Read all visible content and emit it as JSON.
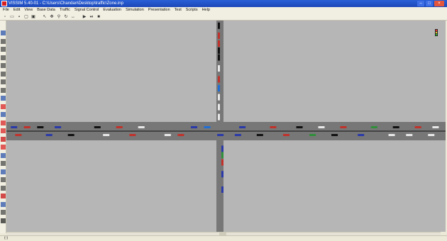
{
  "window": {
    "title": "VISSIM 5.40-01 - C:\\Users\\Chandan\\Desktop\\traffic\\Zone.inp",
    "minimize_glyph": "–",
    "maximize_glyph": "□",
    "close_glyph": "×"
  },
  "menu": [
    "File",
    "Edit",
    "View",
    "Base Data",
    "Traffic",
    "Signal Control",
    "Evaluation",
    "Simulation",
    "Presentation",
    "Test",
    "Scripts",
    "Help"
  ],
  "toolbar_icons": [
    "new-file-icon",
    "open-folder-icon",
    "save-icon",
    "print-preview-icon",
    "print-icon",
    "select-icon",
    "pan-icon",
    "zoom-icon",
    "rotate-icon",
    "measure-icon",
    "play-icon",
    "step-icon",
    "stop-icon"
  ],
  "left_toolbar_icons": [
    "links-icon",
    "connector-icon",
    "pen-icon",
    "hand-icon",
    "route-icon",
    "vehicle-input-icon",
    "priority-rule-icon",
    "selection-icon",
    "parking-icon",
    "signal-head-icon",
    "detector-icon",
    "speed-icon",
    "conflict-icon",
    "stop-sign-icon",
    "pt-stop-icon",
    "node-icon",
    "data-collection-icon",
    "queue-counter-icon",
    "travel-time-icon",
    "delay-icon",
    "warning-icon",
    "parking-lot-icon",
    "area-icon",
    "close-icon"
  ],
  "status": {
    "coordinates": "(-)",
    "field2": "",
    "field3": ""
  },
  "colors": {
    "background": "#b6b6b6",
    "road": "#777777",
    "centerline": "#111111"
  },
  "vehicles_horizontal_top": [
    {
      "x": 0.01,
      "color": "#2a3aa8"
    },
    {
      "x": 0.04,
      "color": "#c0322b"
    },
    {
      "x": 0.07,
      "color": "#111111"
    },
    {
      "x": 0.11,
      "color": "#2a3aa8"
    },
    {
      "x": 0.2,
      "color": "#111111"
    },
    {
      "x": 0.25,
      "color": "#c0322b"
    },
    {
      "x": 0.3,
      "color": "#e8e8e8"
    },
    {
      "x": 0.42,
      "color": "#2a3aa8"
    },
    {
      "x": 0.45,
      "color": "#1f6fd6"
    },
    {
      "x": 0.53,
      "color": "#2a3aa8"
    },
    {
      "x": 0.6,
      "color": "#c0322b"
    },
    {
      "x": 0.66,
      "color": "#111111"
    },
    {
      "x": 0.71,
      "color": "#e8e8e8"
    },
    {
      "x": 0.76,
      "color": "#c0322b"
    },
    {
      "x": 0.83,
      "color": "#2f8f3a"
    },
    {
      "x": 0.88,
      "color": "#111111"
    },
    {
      "x": 0.93,
      "color": "#c0322b"
    },
    {
      "x": 0.97,
      "color": "#e8e8e8"
    }
  ],
  "vehicles_horizontal_bottom": [
    {
      "x": 0.02,
      "color": "#c0322b"
    },
    {
      "x": 0.09,
      "color": "#2a3aa8"
    },
    {
      "x": 0.14,
      "color": "#111111"
    },
    {
      "x": 0.22,
      "color": "#e8e8e8"
    },
    {
      "x": 0.28,
      "color": "#c0322b"
    },
    {
      "x": 0.36,
      "color": "#e8e8e8"
    },
    {
      "x": 0.39,
      "color": "#c0322b"
    },
    {
      "x": 0.48,
      "color": "#2a3aa8"
    },
    {
      "x": 0.52,
      "color": "#2a3aa8"
    },
    {
      "x": 0.57,
      "color": "#111111"
    },
    {
      "x": 0.63,
      "color": "#c0322b"
    },
    {
      "x": 0.69,
      "color": "#2f8f3a"
    },
    {
      "x": 0.74,
      "color": "#111111"
    },
    {
      "x": 0.8,
      "color": "#2a3aa8"
    },
    {
      "x": 0.87,
      "color": "#e8e8e8"
    },
    {
      "x": 0.91,
      "color": "#e8e8e8"
    },
    {
      "x": 0.96,
      "color": "#e8e8e8"
    }
  ],
  "vehicles_vertical_top": [
    {
      "y": 0.02,
      "color": "#111111"
    },
    {
      "y": 0.12,
      "color": "#c0322b"
    },
    {
      "y": 0.2,
      "color": "#c0322b"
    },
    {
      "y": 0.27,
      "color": "#111111"
    },
    {
      "y": 0.34,
      "color": "#111111"
    },
    {
      "y": 0.45,
      "color": "#e8e8e8"
    },
    {
      "y": 0.56,
      "color": "#c0322b"
    },
    {
      "y": 0.65,
      "color": "#1f6fd6"
    },
    {
      "y": 0.74,
      "color": "#e8e8e8"
    },
    {
      "y": 0.84,
      "color": "#e8e8e8"
    },
    {
      "y": 0.94,
      "color": "#e8e8e8"
    }
  ],
  "vehicles_vertical_bottom": [
    {
      "y": 0.05,
      "color": "#2a3aa8"
    },
    {
      "y": 0.12,
      "color": "#2f8f3a"
    },
    {
      "y": 0.2,
      "color": "#c0322b"
    },
    {
      "y": 0.33,
      "color": "#2a3aa8"
    },
    {
      "y": 0.5,
      "color": "#2a3aa8"
    }
  ]
}
